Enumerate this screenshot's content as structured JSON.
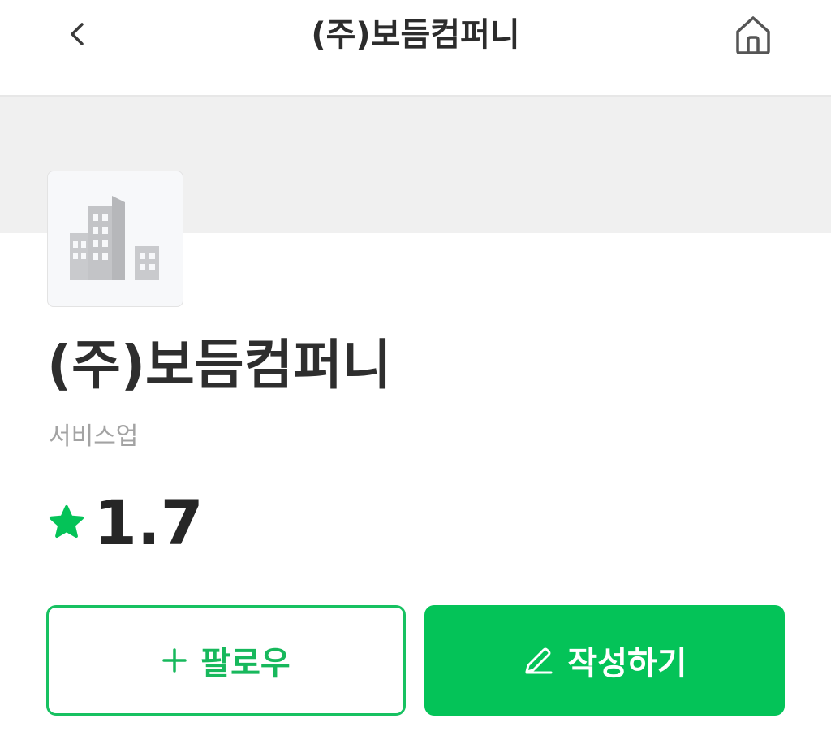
{
  "header": {
    "title": "(주)보듬컴퍼니",
    "back_icon": "chevron-left-icon",
    "home_icon": "home-icon"
  },
  "company": {
    "name": "(주)보듬컴퍼니",
    "industry": "서비스업",
    "logo_icon": "building-icon",
    "rating": "1.7",
    "rating_icon": "star-icon"
  },
  "actions": {
    "follow_label": "팔로우",
    "follow_icon": "plus-icon",
    "write_label": "작성하기",
    "write_icon": "pencil-icon"
  },
  "colors": {
    "accent": "#04c358",
    "banner": "#f0f0f0",
    "text_primary": "#2e2e2e",
    "text_secondary": "#a3a3a3"
  }
}
